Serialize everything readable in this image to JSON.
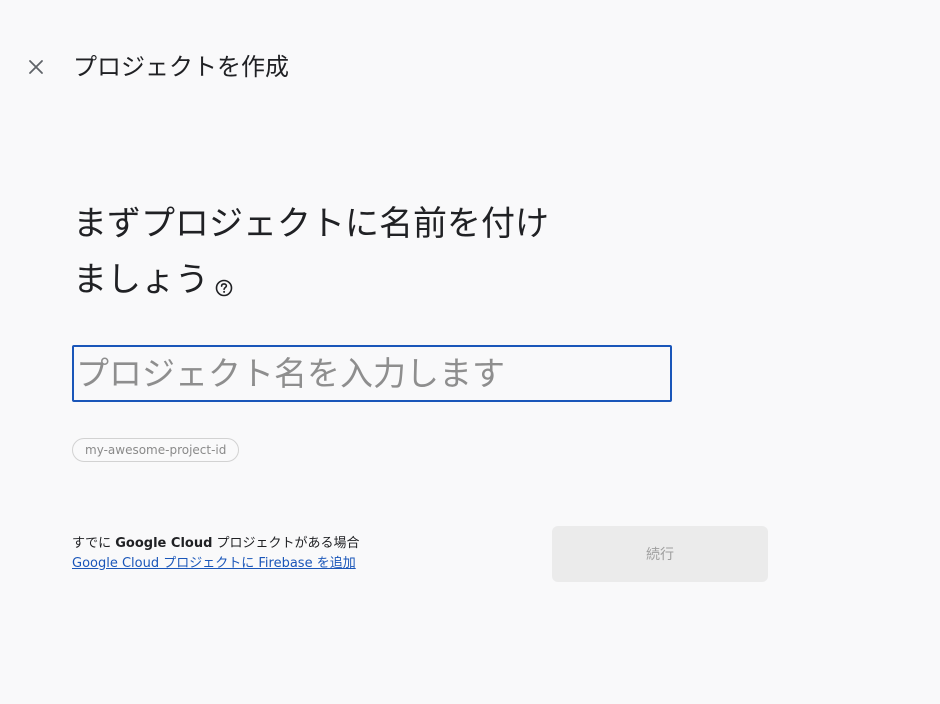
{
  "header": {
    "title": "プロジェクトを作成",
    "close_icon": "close-icon"
  },
  "main": {
    "heading": "まずプロジェクトに名前を付けましょう",
    "help_icon": "help-circle-icon",
    "name_input": {
      "value": "",
      "placeholder": "プロジェクト名を入力します"
    },
    "project_id": "my-awesome-project-id"
  },
  "footer": {
    "gcp_prefix": "すでに ",
    "gcp_bold": "Google Cloud",
    "gcp_suffix": " プロジェクトがある場合",
    "gcp_link": "Google Cloud プロジェクトに Firebase を追加",
    "continue_label": "続行"
  },
  "colors": {
    "accent": "#1a56b9",
    "background": "#f9f9fa",
    "button_disabled_bg": "#ebebeb",
    "button_disabled_text": "#9e9e9e"
  }
}
